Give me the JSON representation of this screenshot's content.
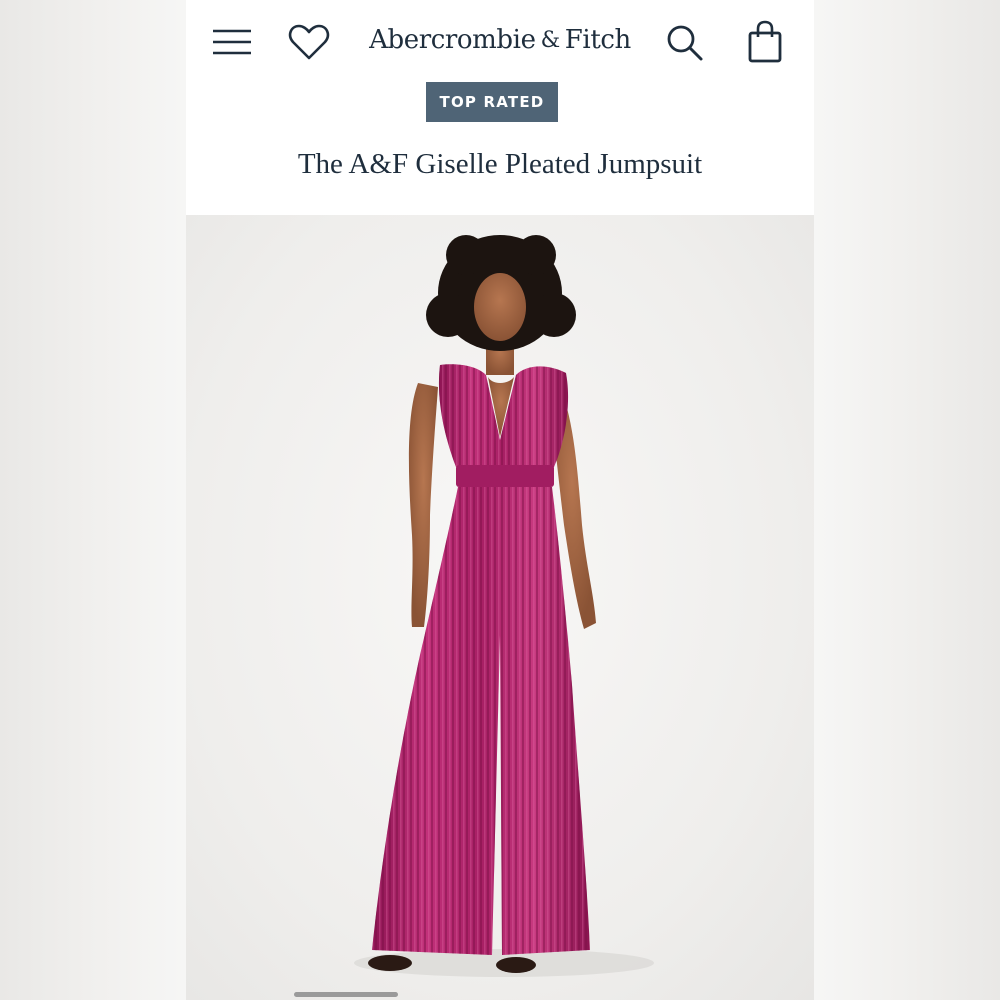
{
  "header": {
    "brand_left": "Abercrombie",
    "brand_amp": "&",
    "brand_right": "Fitch",
    "icons": {
      "menu": "hamburger-menu-icon",
      "wishlist": "heart-icon",
      "search": "search-icon",
      "bag": "shopping-bag-icon"
    },
    "icon_color": "#1f2e3d"
  },
  "product": {
    "badge": "TOP RATED",
    "badge_color": "#4f6476",
    "title": "The A&F Giselle Pleated Jumpsuit",
    "garment_color": "#b0266c"
  }
}
